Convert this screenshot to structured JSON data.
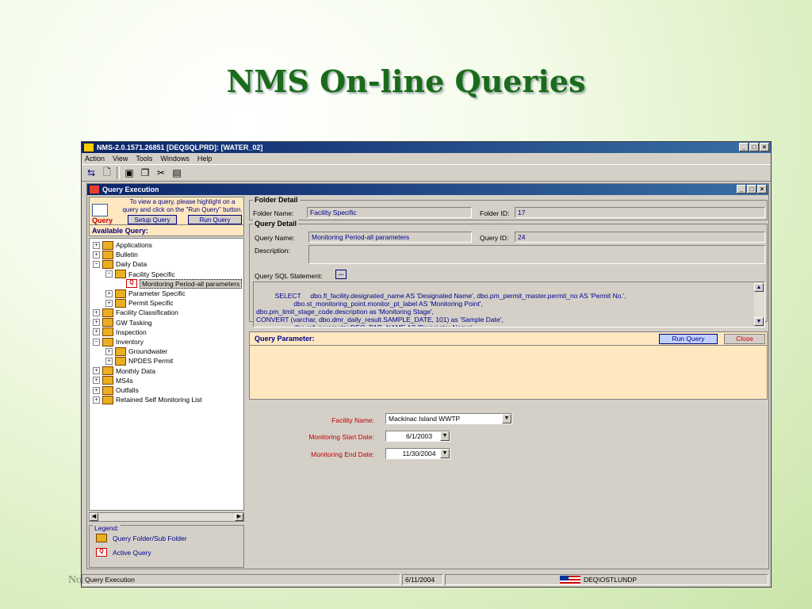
{
  "slide": {
    "title": "NMS On-line Queries",
    "footer_fragment": "No"
  },
  "window": {
    "title": "NMS-2.0.1571.26851  [DEQSQLPRD]: [WATER_02]",
    "min": "_",
    "max": "□",
    "close": "×"
  },
  "menu": [
    "Action",
    "View",
    "Tools",
    "Windows",
    "Help"
  ],
  "child": {
    "title": "Query Execution"
  },
  "left": {
    "hint_text": "To view a query, please highlight on a query and click on the \"Run Query\" button.",
    "query_label": "Query",
    "setup_button": "Setup Query",
    "run_button": "Run Query",
    "available": "Available Query:",
    "tree": [
      {
        "label": "Applications",
        "level": 0,
        "exp": "+"
      },
      {
        "label": "Bulletin",
        "level": 0,
        "exp": "+"
      },
      {
        "label": "Daily Data",
        "level": 0,
        "exp": "−"
      },
      {
        "label": "Facility Specific",
        "level": 1,
        "exp": "−"
      },
      {
        "label": "Monitoring Period-all parameters",
        "level": 2,
        "exp": ""
      },
      {
        "label": "Parameter Specific",
        "level": 1,
        "exp": "+"
      },
      {
        "label": "Permit Specific",
        "level": 1,
        "exp": "+"
      },
      {
        "label": "Facility Classification",
        "level": 0,
        "exp": "+"
      },
      {
        "label": "GW Tasking",
        "level": 0,
        "exp": "+"
      },
      {
        "label": "Inspection",
        "level": 0,
        "exp": "+"
      },
      {
        "label": "Inventory",
        "level": 0,
        "exp": "−"
      },
      {
        "label": "Groundwater",
        "level": 1,
        "exp": "+"
      },
      {
        "label": "NPDES Permit",
        "level": 1,
        "exp": "+"
      },
      {
        "label": "Monthly Data",
        "level": 0,
        "exp": "+"
      },
      {
        "label": "MS4s",
        "level": 0,
        "exp": "+"
      },
      {
        "label": "Outfalls",
        "level": 0,
        "exp": "+"
      },
      {
        "label": "Retained Self Monitoring List",
        "level": 0,
        "exp": "+"
      }
    ],
    "legend_title": "Legend:",
    "legend_folder": "Query Folder/Sub Folder",
    "legend_query": "Active Query"
  },
  "folder": {
    "title": "Folder Detail",
    "name_label": "Folder Name:",
    "name": "Facility Specific",
    "id_label": "Folder ID:",
    "id": "17"
  },
  "query": {
    "title": "Query Detail",
    "name_label": "Query Name:",
    "name": "Monitoring Period-all parameters",
    "id_label": "Query ID:",
    "id": "24",
    "desc_label": "Description:",
    "desc": "",
    "sql_label": "Query SQL Statement:",
    "sql_btn": "...",
    "sql": "SELECT     dbo.fl_facility.designated_name AS 'Designated Name', dbo.pm_permit_master.permit_no AS 'Permit No.',\n                    dbo.st_monitoring_point.monitor_pt_label AS 'Monitoring Point',\ndbo.pm_limit_stage_code.description as 'Monitoring Stage',\nCONVERT (varchar, dbo.dmr_daily_result.SAMPLE_DATE, 101) as 'Sample Date',\n                    dbo.ref_parameter.DEQ_PAR_NAME AS 'Parameter Name',"
  },
  "param": {
    "title": "Query Parameter:",
    "run": "Run Query",
    "close": "Close"
  },
  "fields": {
    "facility_label": "Facility Name:",
    "facility": "Mackinac Island WWTP",
    "start_label": "Monitoring Start Date:",
    "start": "6/1/2003",
    "end_label": "Monitoring End Date:",
    "end": "11/30/2004"
  },
  "status": {
    "panel1": "Query Execution",
    "date": "6/11/2004",
    "user": "DEQ\\OSTLUNDP"
  }
}
